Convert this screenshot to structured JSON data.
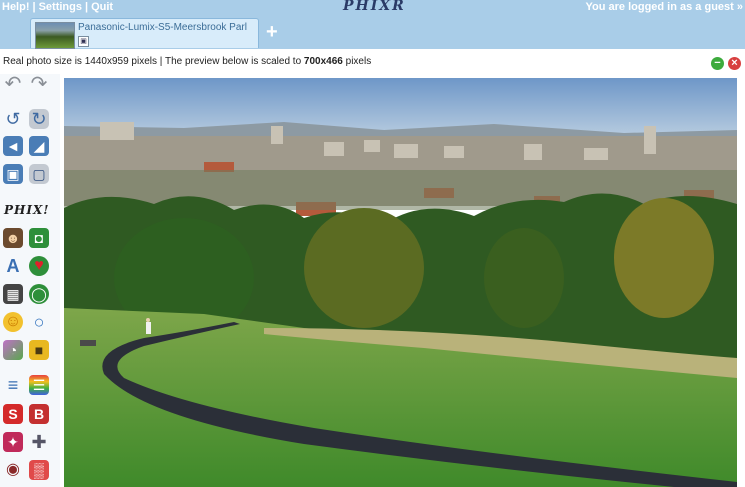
{
  "topbar": {
    "help": "Help!",
    "settings": "Settings",
    "quit": "Quit",
    "separator": "|",
    "logo": "PHIXR",
    "login_status": "You are logged in as a guest »"
  },
  "tabs": [
    {
      "title": "Panasonic-Lumix-S5-Meersbrook Parl"
    }
  ],
  "add_tab": "+",
  "info": {
    "prefix": "Real photo size is 1440x959 pixels | The preview below is scaled to ",
    "scaled": "700x466",
    "suffix": " pixels"
  },
  "toolbar": {
    "section_label": "PHIX!",
    "icons": {
      "undo": "↶",
      "redo": "↷",
      "rotate_left": "↺",
      "rotate_right": "↻",
      "flip_h": "◄",
      "crop_select": "◢",
      "resize_small": "▣",
      "resize_large": "▢",
      "portrait": "☻",
      "camera": "◘",
      "text": "A",
      "heart": "♥",
      "frame": "▦",
      "shape": "◯",
      "smiley": "☺",
      "speech": "○",
      "bubble_pair": "◔",
      "sticky": "■",
      "sliders": "≡",
      "colors": "☰",
      "s_icon": "S",
      "b_icon": "B",
      "effect": "✦",
      "puzzle": "✚",
      "eye": "◉",
      "pattern": "▒"
    }
  },
  "colors": {
    "header": "#a9cde8",
    "tab_bg": "#d8ecfa",
    "link_text": "#3b6d97"
  }
}
